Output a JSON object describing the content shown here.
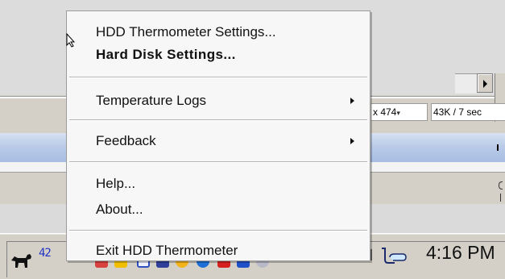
{
  "menu": {
    "items": [
      {
        "label": "HDD Thermometer Settings...",
        "bold": false,
        "submenu": false
      },
      {
        "label": "Hard Disk Settings...",
        "bold": true,
        "submenu": false
      },
      {
        "label": "Temperature Logs",
        "bold": false,
        "submenu": true
      },
      {
        "label": "Feedback",
        "bold": false,
        "submenu": true
      },
      {
        "label": "Help...",
        "bold": false,
        "submenu": false
      },
      {
        "label": "About...",
        "bold": false,
        "submenu": false
      },
      {
        "label": "Exit HDD Thermometer",
        "bold": false,
        "submenu": false
      }
    ]
  },
  "background_window": {
    "status_size": "x 474",
    "status_bytes": "43K / 7 sec"
  },
  "taskbar": {
    "tray_temperature": "42",
    "clock": "4:16 PM",
    "tray_icon_names": [
      "dog-icon",
      "speaker-icon",
      "folder-icon",
      "window-icon",
      "monitor-icon",
      "sun-icon",
      "globe-icon",
      "heart-icon",
      "screen-icon",
      "user-icon",
      "audio-icon",
      "network-bubble-icon"
    ]
  },
  "colors": {
    "menu_background": "#f7f7f7",
    "taskbar": "#d4d0c8",
    "tray_temperature": "#2034c4",
    "blue_band": "#b9cbe8"
  }
}
